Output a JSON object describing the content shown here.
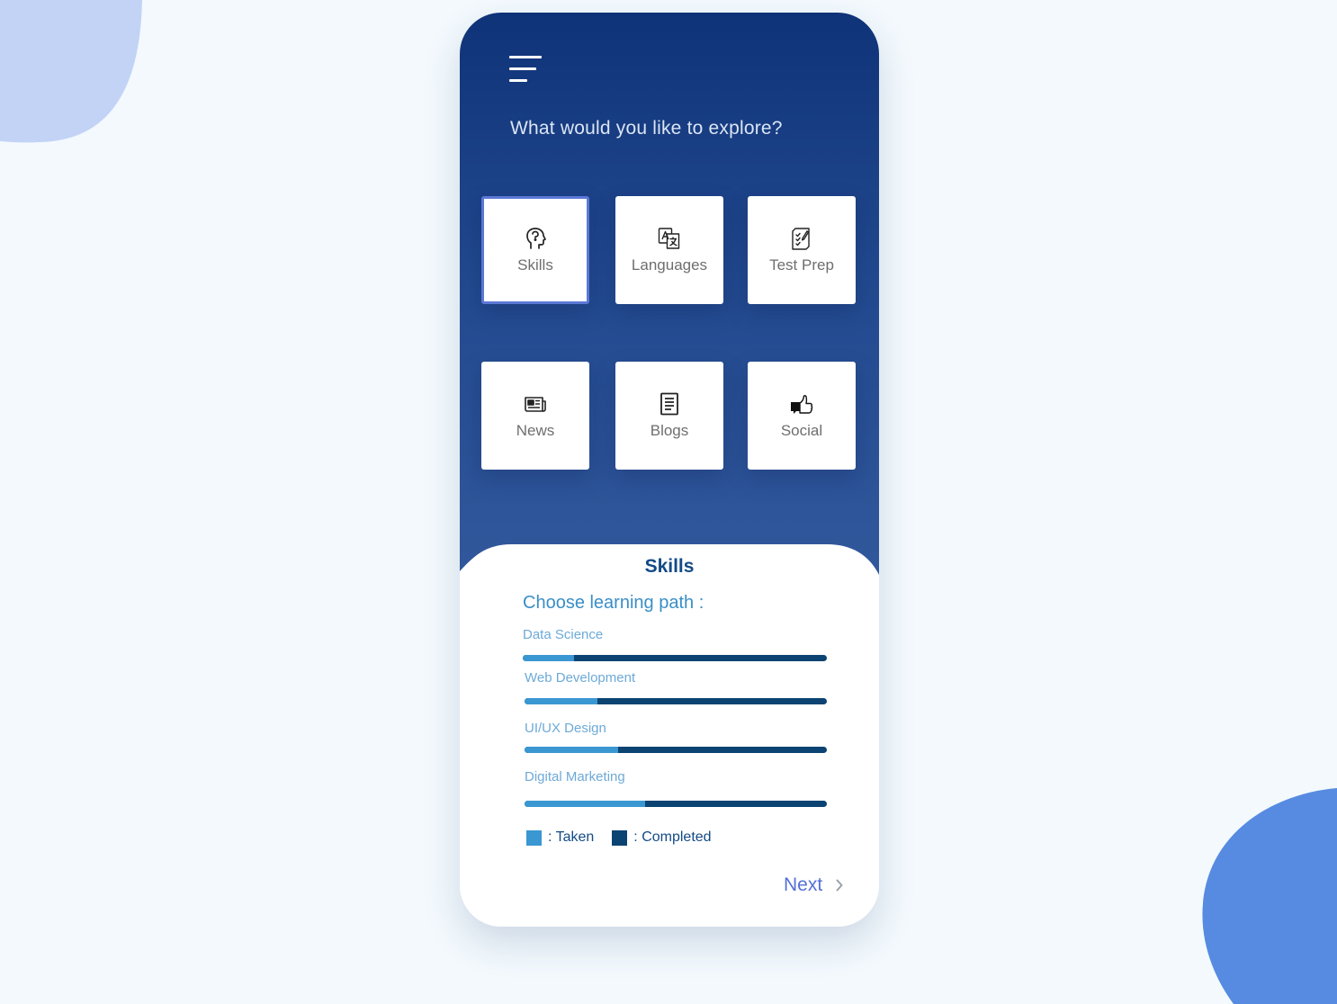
{
  "header": {
    "question": "What would you like to explore?"
  },
  "categories": [
    {
      "label": "Skills",
      "icon": "head-profile-icon",
      "selected": true
    },
    {
      "label": "Languages",
      "icon": "translate-icon"
    },
    {
      "label": "Test Prep",
      "icon": "checklist-icon"
    },
    {
      "label": "News",
      "icon": "newspaper-icon"
    },
    {
      "label": "Blogs",
      "icon": "document-icon"
    },
    {
      "label": "Social",
      "icon": "thumbs-up-icon"
    }
  ],
  "panel": {
    "title": "Skills",
    "subtitle": "Choose learning path :",
    "paths": [
      {
        "label": "Data Science",
        "taken": 0.17
      },
      {
        "label": "Web Development",
        "taken": 0.24
      },
      {
        "label": "UI/UX Design",
        "taken": 0.31
      },
      {
        "label": "Digital Marketing",
        "taken": 0.4
      }
    ],
    "legend": {
      "taken": ": Taken",
      "completed": ": Completed"
    },
    "next_label": "Next"
  },
  "colors": {
    "background": "#f3f9fd",
    "header_top": "#0f3378",
    "header_bottom": "#33599d",
    "taken": "#3a97d2",
    "completed": "#0b4372",
    "accent": "#5570d8"
  }
}
